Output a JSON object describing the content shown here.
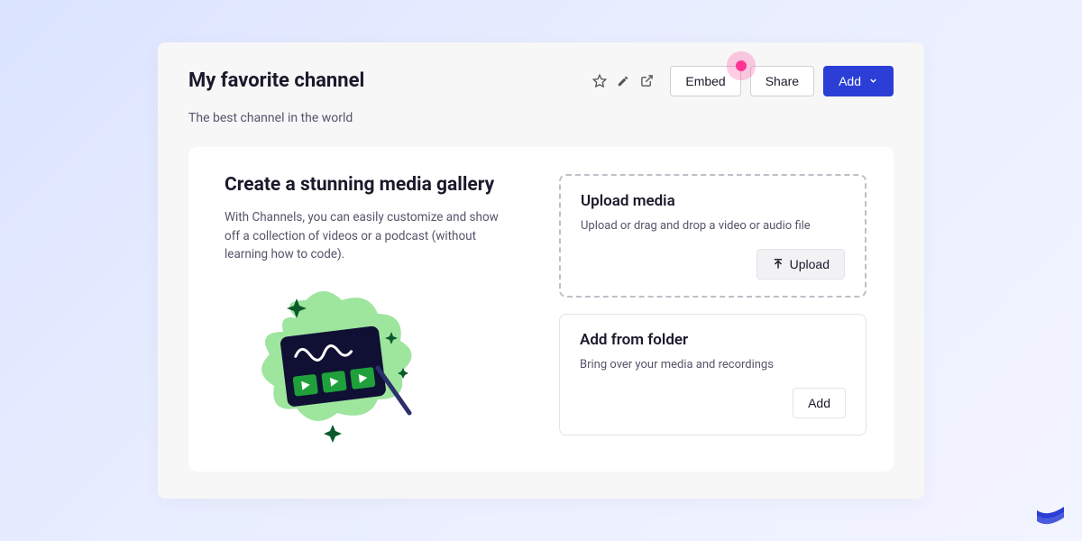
{
  "header": {
    "title": "My favorite channel",
    "subtitle": "The best channel in the world",
    "embed_label": "Embed",
    "share_label": "Share",
    "add_label": "Add"
  },
  "gallery": {
    "heading": "Create a stunning media gallery",
    "description": "With Channels, you can easily customize and show off a collection of videos or a podcast (without learning how to code)."
  },
  "upload_box": {
    "title": "Upload media",
    "description": "Upload or drag and drop a video or audio file",
    "button": "Upload"
  },
  "folder_box": {
    "title": "Add from folder",
    "description": "Bring over your media and recordings",
    "button": "Add"
  }
}
